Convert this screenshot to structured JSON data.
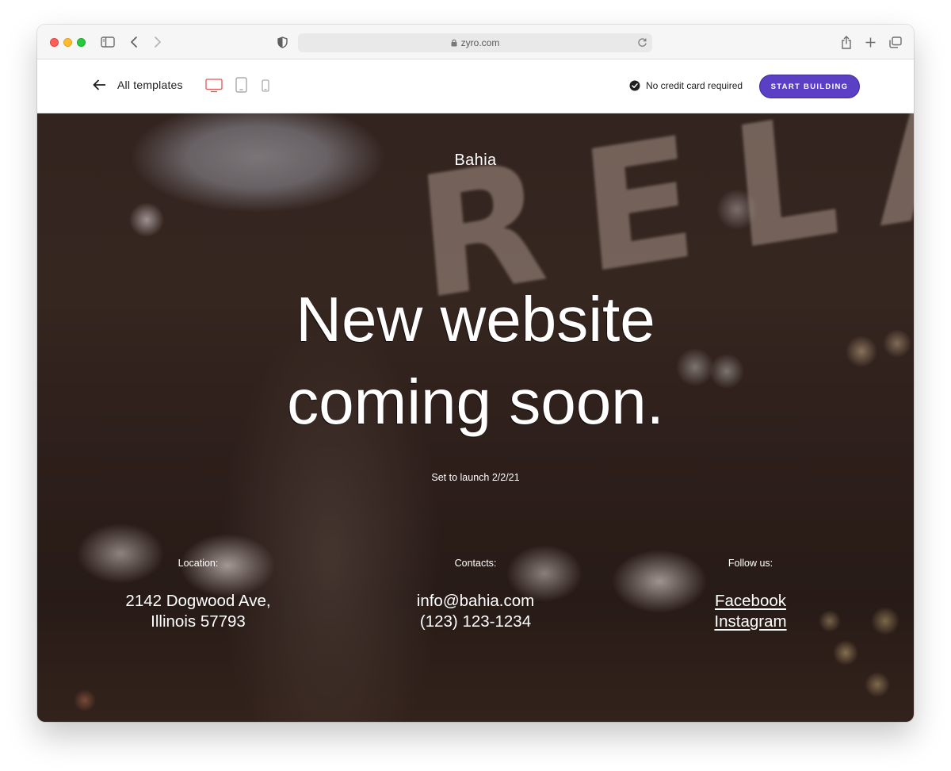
{
  "browser": {
    "url": "zyro.com"
  },
  "toolbar": {
    "back_label": "All templates",
    "no_cc_label": "No credit card required",
    "start_label": "START BUILDING",
    "devices": [
      "desktop-icon",
      "tablet-icon",
      "mobile-icon"
    ],
    "accent_color": "#5b40c6",
    "active_device_color": "#e05555"
  },
  "hero": {
    "brand": "Bahia",
    "headline_line1": "New website",
    "headline_line2": "coming soon.",
    "launch_text": "Set to launch 2/2/21",
    "background_sign": "RELAX",
    "location": {
      "label": "Location:",
      "line1": "2142 Dogwood Ave,",
      "line2": "Illinois 57793"
    },
    "contacts": {
      "label": "Contacts:",
      "email": "info@bahia.com",
      "phone": "(123) 123-1234"
    },
    "follow": {
      "label": "Follow us:",
      "facebook": "Facebook",
      "instagram": "Instagram"
    }
  }
}
